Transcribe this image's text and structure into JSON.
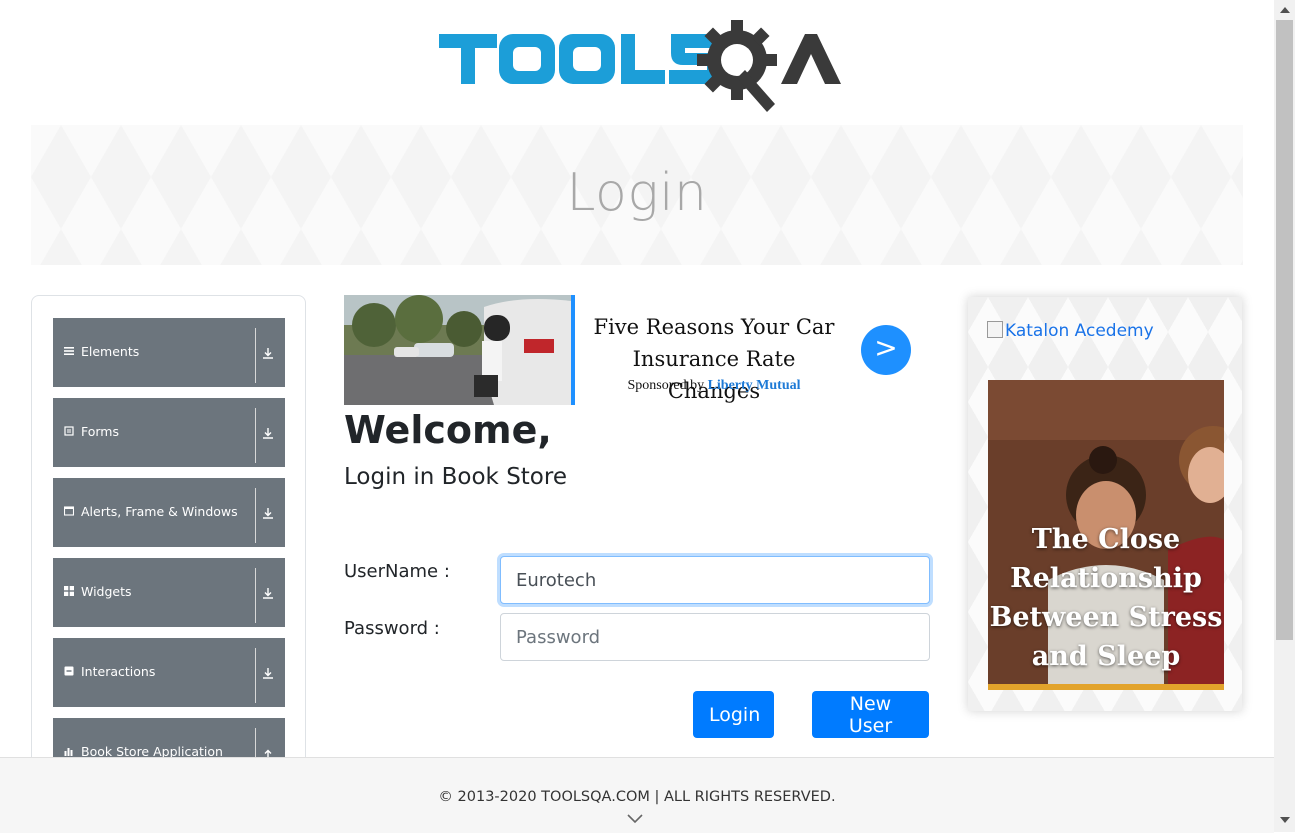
{
  "logo": {
    "brand": "TOOLSQA"
  },
  "banner": {
    "title": "Login"
  },
  "sidebar": {
    "groups": [
      {
        "label": "Elements",
        "icon": "hamburger-icon"
      },
      {
        "label": "Forms",
        "icon": "form-icon"
      },
      {
        "label": "Alerts, Frame & Windows",
        "icon": "window-icon"
      },
      {
        "label": "Widgets",
        "icon": "grid-icon"
      },
      {
        "label": "Interactions",
        "icon": "interactions-icon"
      },
      {
        "label": "Book Store Application",
        "icon": "chart-icon"
      }
    ]
  },
  "ad": {
    "headline": "Five Reasons Your Car Insurance Rate Changes",
    "sponsored_prefix": "Sponsored by",
    "sponsor": "Liberty Mutual",
    "go": ">"
  },
  "main": {
    "welcome": "Welcome,",
    "subtitle": "Login in Book Store",
    "username_label": "UserName :",
    "username_value": "Eurotech",
    "password_label": "Password :",
    "password_placeholder": "Password",
    "login_button": "Login",
    "new_user_button": "New User"
  },
  "right_ad": {
    "alt_link": "Katalon Acedemy",
    "promo_text": "The Close Relationship Between Stress and Sleep"
  },
  "footer": {
    "copyright": "© 2013-2020 TOOLSQA.COM | ALL RIGHTS RESERVED."
  },
  "colors": {
    "primary": "#007bff",
    "nav": "#6c757d",
    "logo_blue": "#1c9ed8",
    "logo_dark": "#3a3a3a"
  }
}
